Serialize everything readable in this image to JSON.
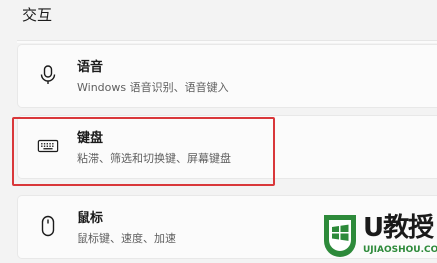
{
  "section": {
    "title": "交互"
  },
  "items": [
    {
      "label": "语音",
      "description": "Windows 语音识别、语音键入",
      "icon": "microphone-icon"
    },
    {
      "label": "键盘",
      "description": "粘滞、筛选和切换键、屏幕键盘",
      "icon": "keyboard-icon"
    },
    {
      "label": "鼠标",
      "description": "鼠标键、速度、加速",
      "icon": "mouse-icon"
    }
  ],
  "watermark": {
    "brand": "U教授",
    "url": "UJIAOSHOU.COM"
  },
  "colors": {
    "highlight": "#d9373a",
    "watermark_green": "#2d8a3a",
    "background": "#f3f3f3",
    "card": "#fbfbfb"
  }
}
